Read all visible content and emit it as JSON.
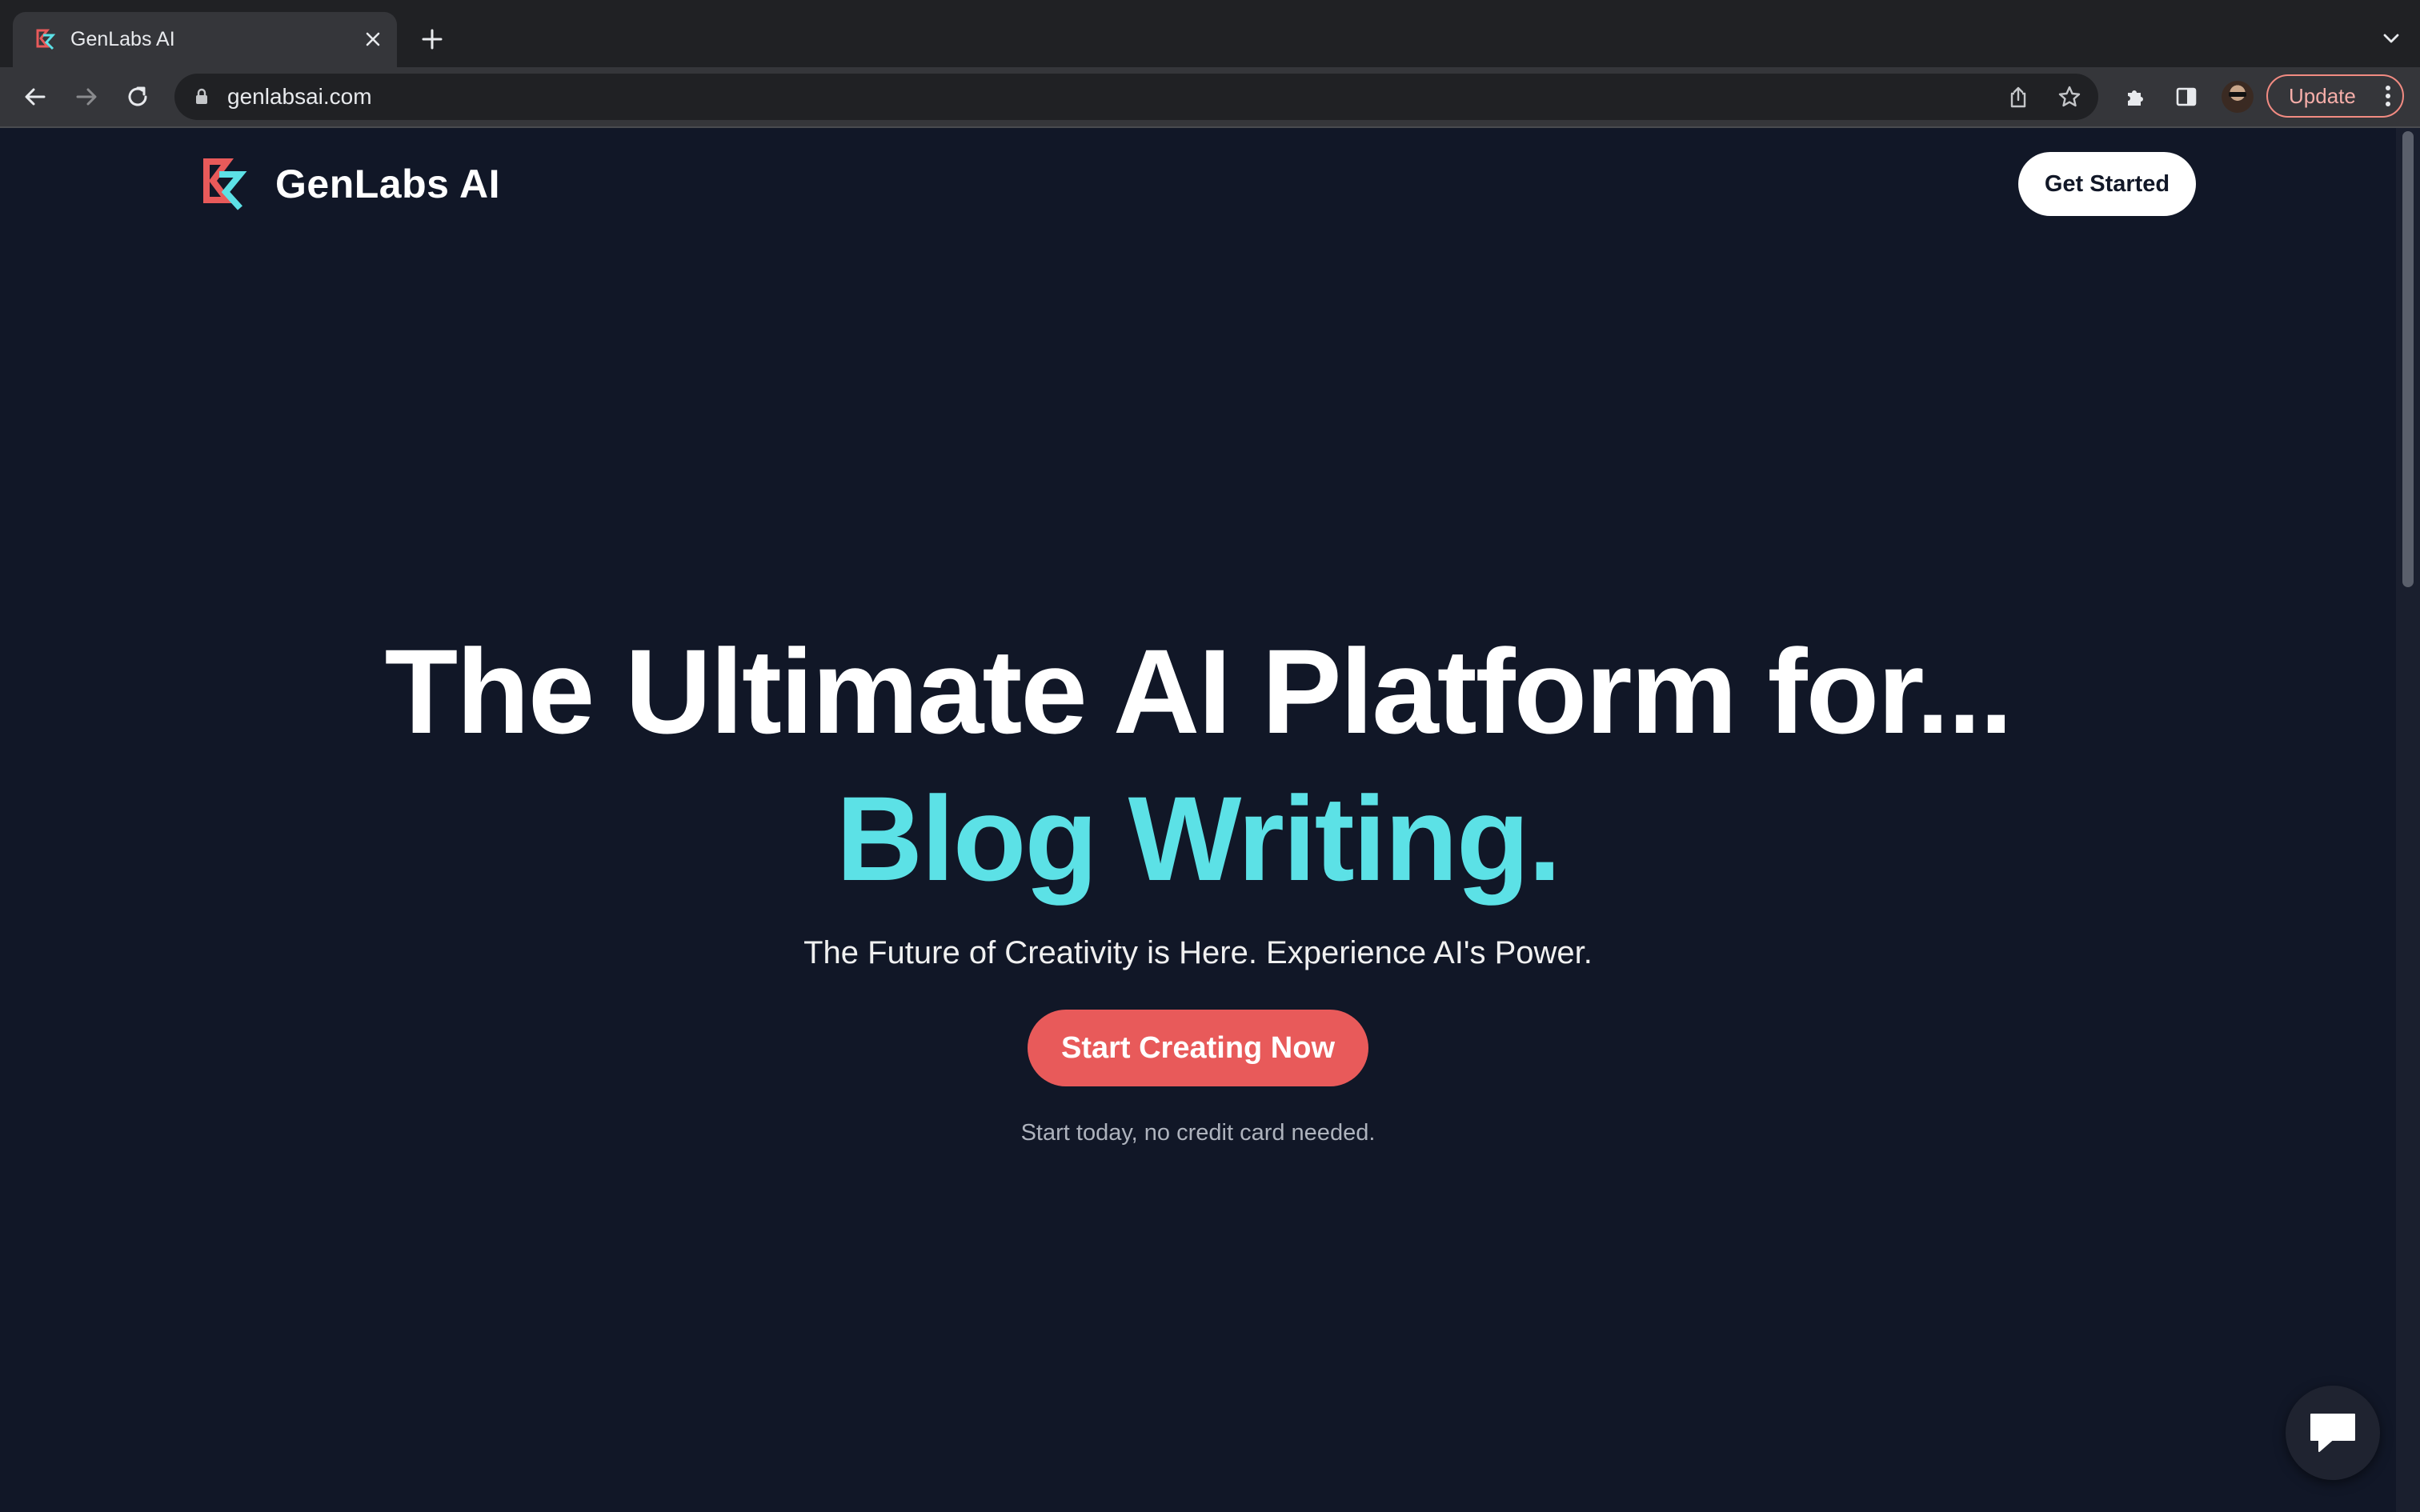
{
  "browser": {
    "tab": {
      "title": "GenLabs AI"
    },
    "address_bar": {
      "url": "genlabsai.com"
    },
    "update_label": "Update"
  },
  "header": {
    "brand_name": "GenLabs AI",
    "cta_label": "Get Started"
  },
  "hero": {
    "title": "The Ultimate AI Platform for...",
    "accent_text": "Blog Writing.",
    "subtitle": "The Future of Creativity is Here. Experience AI's Power.",
    "cta_label": "Start Creating Now",
    "note": "Start today, no credit card needed."
  },
  "colors": {
    "page_background": "#111727",
    "accent": "#5ce1e6",
    "cta": "#e85a5a",
    "logo_red": "#e85a5a",
    "logo_cyan": "#5ce1e6"
  },
  "icons": [
    "favicon",
    "close-icon",
    "plus-icon",
    "chevron-down-icon",
    "back-arrow-icon",
    "forward-arrow-icon",
    "reload-icon",
    "lock-icon",
    "share-icon",
    "star-icon",
    "extensions-icon",
    "side-panel-icon",
    "kebab-menu-icon",
    "chat-icon"
  ]
}
